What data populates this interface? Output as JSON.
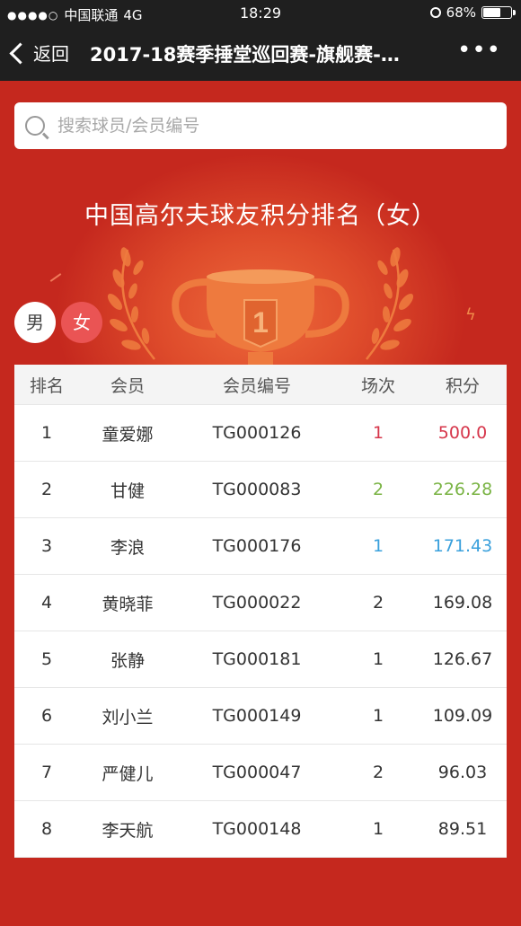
{
  "status_bar": {
    "carrier": "中国联通",
    "network": "4G",
    "time": "18:29",
    "battery": "68%",
    "battery_level": 0.68
  },
  "nav": {
    "back_label": "返回",
    "title": "2017-18赛季捶堂巡回赛-旗舰赛-…",
    "more_label": "•••"
  },
  "search": {
    "placeholder": "搜索球员/会员编号",
    "value": ""
  },
  "ranking_title": "中国高尔夫球友积分排名（女）",
  "gender_tabs": {
    "male": "男",
    "female": "女",
    "active": "female"
  },
  "colors": {
    "background": "#c5281e",
    "rank1": "#d6354a",
    "rank2": "#79b343",
    "rank3": "#3aa0dc"
  },
  "table": {
    "headers": [
      "排名",
      "会员",
      "会员编号",
      "场次",
      "积分"
    ],
    "rows": [
      {
        "rank": "1",
        "name": "童爱娜",
        "id": "TG000126",
        "games": "1",
        "points": "500.0"
      },
      {
        "rank": "2",
        "name": "甘健",
        "id": "TG000083",
        "games": "2",
        "points": "226.28"
      },
      {
        "rank": "3",
        "name": "李浪",
        "id": "TG000176",
        "games": "1",
        "points": "171.43"
      },
      {
        "rank": "4",
        "name": "黄晓菲",
        "id": "TG000022",
        "games": "2",
        "points": "169.08"
      },
      {
        "rank": "5",
        "name": "张静",
        "id": "TG000181",
        "games": "1",
        "points": "126.67"
      },
      {
        "rank": "6",
        "name": "刘小兰",
        "id": "TG000149",
        "games": "1",
        "points": "109.09"
      },
      {
        "rank": "7",
        "name": "严健儿",
        "id": "TG000047",
        "games": "2",
        "points": "96.03"
      },
      {
        "rank": "8",
        "name": "李天航",
        "id": "TG000148",
        "games": "1",
        "points": "89.51"
      }
    ]
  }
}
